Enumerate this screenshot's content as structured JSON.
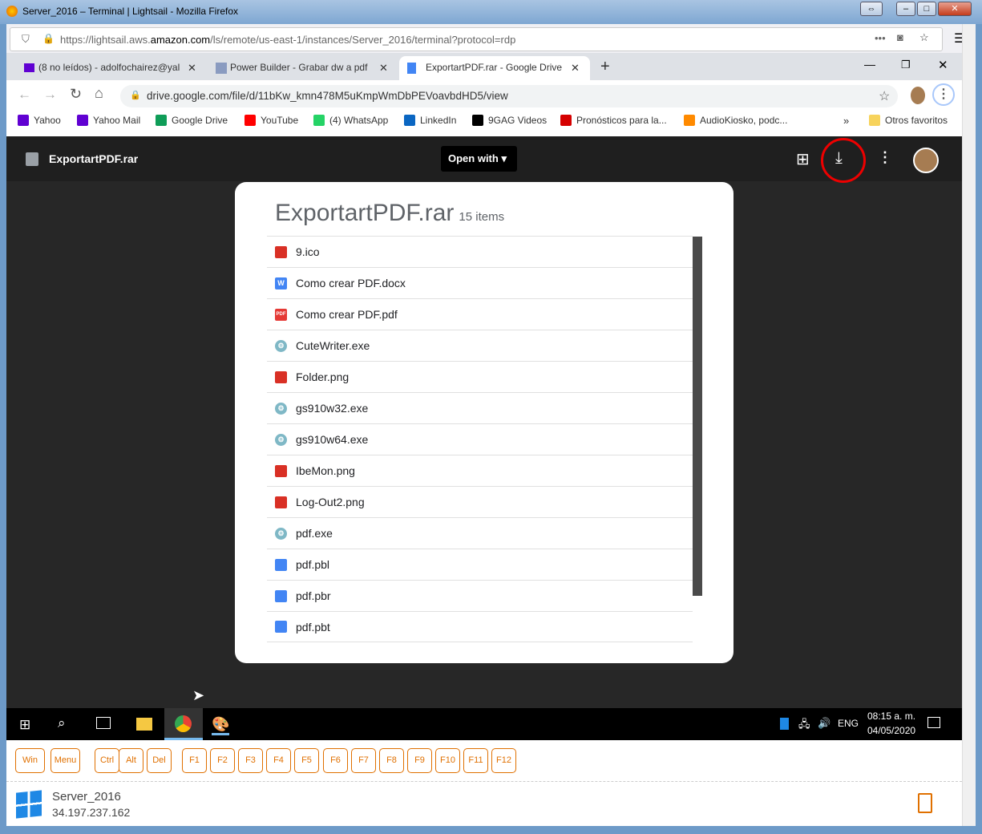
{
  "firefox": {
    "title": "Server_2016 – Terminal | Lightsail - Mozilla Firefox",
    "url_prefix": "https://lightsail.aws.",
    "url_domain": "amazon.com",
    "url_path": "/ls/remote/us-east-1/instances/Server_2016/terminal?protocol=rdp"
  },
  "chrome": {
    "tabs": [
      {
        "label": "(8 no leídos) - adolfochairez@yal",
        "color": "#6001d2"
      },
      {
        "label": "Power Builder - Grabar dw a pdf",
        "color": "#8a9bc0"
      },
      {
        "label": "ExportartPDF.rar - Google Drive",
        "color": "#4285f4"
      }
    ],
    "url": "drive.google.com/file/d/11bKw_kmn478M5uKmpWmDbPEVoavbdHD5/view",
    "bookmarks": [
      {
        "label": "Yahoo",
        "color": "#6001d2"
      },
      {
        "label": "Yahoo Mail",
        "color": "#6001d2"
      },
      {
        "label": "Google Drive",
        "color": "#0f9d58"
      },
      {
        "label": "YouTube",
        "color": "#ff0000"
      },
      {
        "label": "(4) WhatsApp",
        "color": "#25d366"
      },
      {
        "label": "LinkedIn",
        "color": "#0a66c2"
      },
      {
        "label": "9GAG Videos",
        "color": "#000000"
      },
      {
        "label": "Pronósticos para la...",
        "color": "#d50000"
      },
      {
        "label": "AudioKiosko, podc...",
        "color": "#ff8a00"
      }
    ],
    "overflow": "»",
    "other_bookmarks": "Otros favoritos"
  },
  "drive": {
    "filename": "ExportartPDF.rar",
    "open_with": "Open with",
    "archive_title": "ExportartPDF.rar",
    "item_count": "15 items",
    "files": [
      {
        "name": "9.ico",
        "type": "image"
      },
      {
        "name": "Como crear PDF.docx",
        "type": "word"
      },
      {
        "name": "Como crear PDF.pdf",
        "type": "pdf"
      },
      {
        "name": "CuteWriter.exe",
        "type": "exe"
      },
      {
        "name": "Folder.png",
        "type": "image"
      },
      {
        "name": "gs910w32.exe",
        "type": "exe"
      },
      {
        "name": "gs910w64.exe",
        "type": "exe"
      },
      {
        "name": "IbeMon.png",
        "type": "image"
      },
      {
        "name": "Log-Out2.png",
        "type": "image"
      },
      {
        "name": "pdf.exe",
        "type": "exe"
      },
      {
        "name": "pdf.pbl",
        "type": "doc"
      },
      {
        "name": "pdf.pbr",
        "type": "doc"
      },
      {
        "name": "pdf.pbt",
        "type": "doc"
      }
    ]
  },
  "taskbar": {
    "lang": "ENG",
    "time": "08:15 a. m.",
    "date": "04/05/2020"
  },
  "rdp": {
    "keys": [
      "Win",
      "Menu",
      "Ctrl",
      "Alt",
      "Del",
      "F1",
      "F2",
      "F3",
      "F4",
      "F5",
      "F6",
      "F7",
      "F8",
      "F9",
      "F10",
      "F11",
      "F12"
    ],
    "server_name": "Server_2016",
    "ip": "34.197.237.162",
    "accent": "#e07000"
  }
}
